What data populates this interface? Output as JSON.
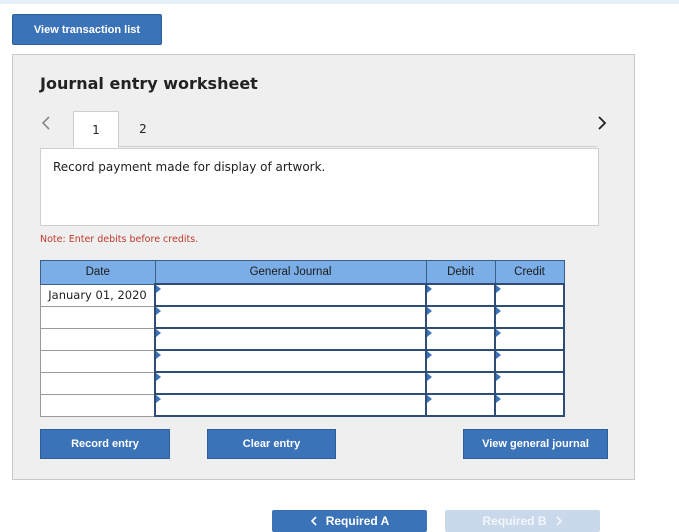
{
  "toolbar": {
    "view_transactions": "View transaction list"
  },
  "worksheet": {
    "title": "Journal entry worksheet",
    "tabs": [
      "1",
      "2"
    ],
    "active_tab": "1",
    "description": "Record payment made for display of artwork.",
    "note": "Note: Enter debits before credits.",
    "columns": [
      "Date",
      "General Journal",
      "Debit",
      "Credit"
    ],
    "rows": [
      {
        "date": "January 01, 2020",
        "account": "",
        "debit": "",
        "credit": ""
      },
      {
        "date": "",
        "account": "",
        "debit": "",
        "credit": ""
      },
      {
        "date": "",
        "account": "",
        "debit": "",
        "credit": ""
      },
      {
        "date": "",
        "account": "",
        "debit": "",
        "credit": ""
      },
      {
        "date": "",
        "account": "",
        "debit": "",
        "credit": ""
      },
      {
        "date": "",
        "account": "",
        "debit": "",
        "credit": ""
      }
    ],
    "buttons": {
      "record": "Record entry",
      "clear": "Clear entry",
      "view_journal": "View general journal"
    }
  },
  "pager": {
    "prev_label": "Required A",
    "next_label": "Required B"
  },
  "icons": {
    "prev": "chevron-left-icon",
    "next": "chevron-right-icon"
  },
  "colors": {
    "button": "#3b73b9",
    "header": "#7baee6",
    "note": "#c0392b",
    "disabled": "#c9d8ea"
  }
}
